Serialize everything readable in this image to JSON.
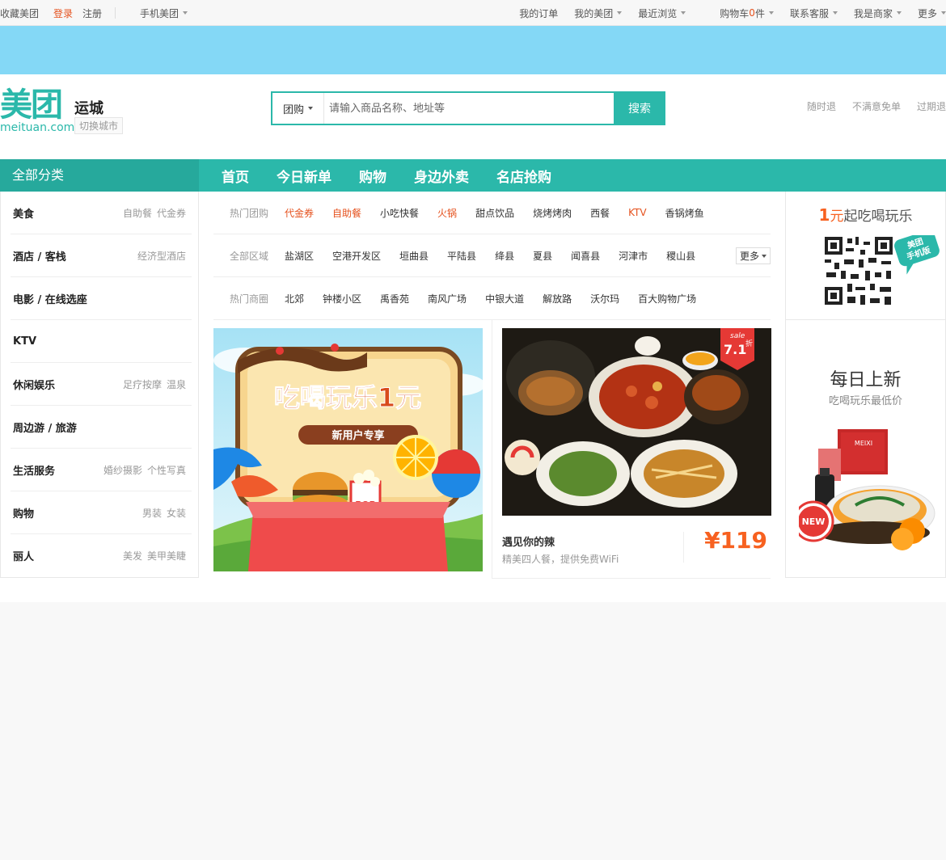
{
  "topbar": {
    "left": [
      "收藏美团",
      "登录",
      "注册"
    ],
    "mobile": "手机美团",
    "right": {
      "orders": "我的订单",
      "my_meituan": "我的美团",
      "recent": "最近浏览",
      "cart_prefix": "购物车",
      "cart_count": "0",
      "cart_suffix": "件",
      "service": "联系客服",
      "merchant": "我是商家",
      "more": "更多"
    }
  },
  "header": {
    "logo_text": "美团",
    "logo_domain": "meituan.com",
    "city": "运城",
    "switch_city": "切换城市",
    "search_category": "团购",
    "search_placeholder": "请输入商品名称、地址等",
    "search_button": "搜索",
    "promises": [
      "随时退",
      "不满意免单",
      "过期退"
    ]
  },
  "nav": {
    "all_categories": "全部分类",
    "links": [
      "首页",
      "今日新单",
      "购物",
      "身边外卖",
      "名店抢购"
    ]
  },
  "categories": [
    {
      "title": "美食",
      "subs": [
        "自助餐",
        "代金券"
      ]
    },
    {
      "title": "酒店 / 客栈",
      "subs": [
        "经济型酒店"
      ]
    },
    {
      "title": "电影 / 在线选座",
      "subs": []
    },
    {
      "title": "KTV",
      "subs": []
    },
    {
      "title": "休闲娱乐",
      "subs": [
        "足疗按摩",
        "温泉"
      ]
    },
    {
      "title": "周边游 / 旅游",
      "subs": []
    },
    {
      "title": "生活服务",
      "subs": [
        "婚纱摄影",
        "个性写真"
      ]
    },
    {
      "title": "购物",
      "subs": [
        "男装",
        "女装"
      ]
    },
    {
      "title": "丽人",
      "subs": [
        "美发",
        "美甲美睫"
      ]
    }
  ],
  "filters": {
    "hot": {
      "label": "热门团购",
      "items": [
        "代金券",
        "自助餐",
        "小吃快餐",
        "火锅",
        "甜点饮品",
        "烧烤烤肉",
        "西餐",
        "KTV",
        "香锅烤鱼"
      ],
      "highlight": [
        0,
        1,
        3,
        7
      ]
    },
    "area": {
      "label": "全部区域",
      "items": [
        "盐湖区",
        "空港开发区",
        "垣曲县",
        "平陆县",
        "绛县",
        "夏县",
        "闻喜县",
        "河津市",
        "稷山县"
      ],
      "more": "更多"
    },
    "circle": {
      "label": "热门商圈",
      "items": [
        "北郊",
        "钟楼小区",
        "禹香苑",
        "南风广场",
        "中银大道",
        "解放路",
        "沃尔玛",
        "百大购物广场"
      ]
    }
  },
  "promo": {
    "title": "吃喝玩乐1元",
    "ribbon": "新用户专享",
    "box_label": "POP"
  },
  "deal": {
    "name": "遇见你的辣",
    "desc": "精美四人餐，提供免费WiFi",
    "price": "¥119",
    "sale_tag": "sale",
    "discount": "7.1",
    "discount_unit": "折"
  },
  "right": {
    "qr_title_num": "1",
    "qr_title_unit": "元",
    "qr_title_rest": "起吃喝玩乐",
    "qr_badge": "美团\n手机版",
    "daily_title": "每日上新",
    "daily_sub": "吃喝玩乐最低价",
    "new_badge": "NEW",
    "meixi": "MEIXI"
  }
}
